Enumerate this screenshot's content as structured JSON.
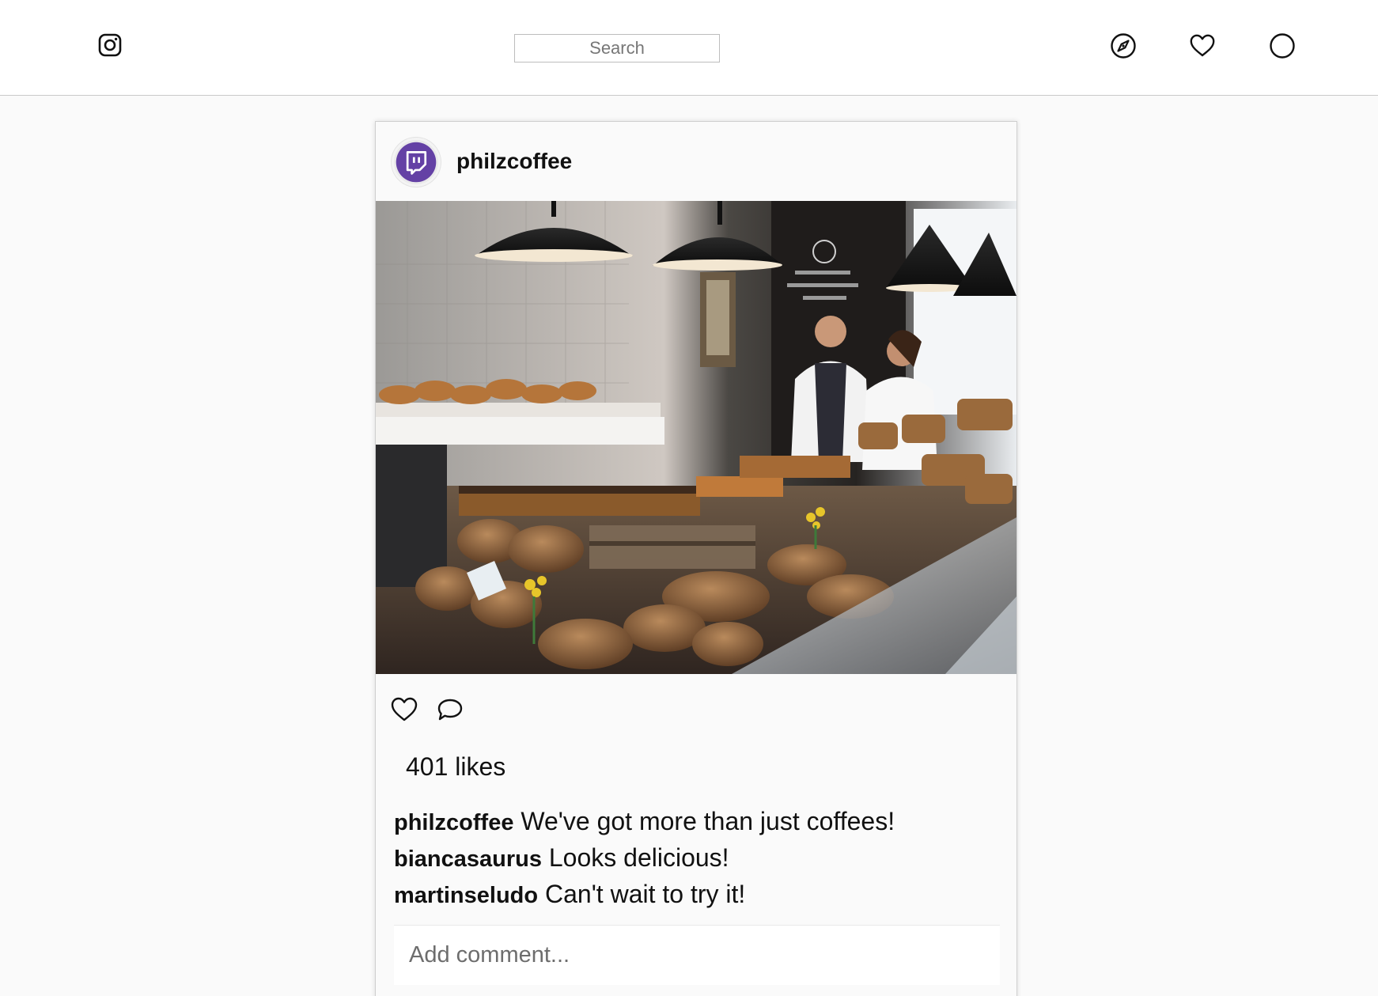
{
  "header": {
    "logo_icon": "instagram-icon",
    "search_placeholder": "Search",
    "nav_icons": [
      "compass-icon",
      "heart-icon",
      "profile-circle-icon"
    ]
  },
  "post": {
    "username": "philzcoffee",
    "avatar_icon": "twitch-chat-icon",
    "avatar_color": "#6441a5",
    "image_alt": "Bakery counter with breads and pastries",
    "actions": [
      "heart-icon",
      "comment-icon"
    ],
    "likes_text": "401 likes",
    "comments": [
      {
        "user": "philzcoffee",
        "text": "We've got more than just coffees!"
      },
      {
        "user": "biancasaurus",
        "text": "Looks delicious!"
      },
      {
        "user": "martinseludo",
        "text": "Can't wait to try it!"
      }
    ],
    "comment_placeholder": "Add comment..."
  }
}
